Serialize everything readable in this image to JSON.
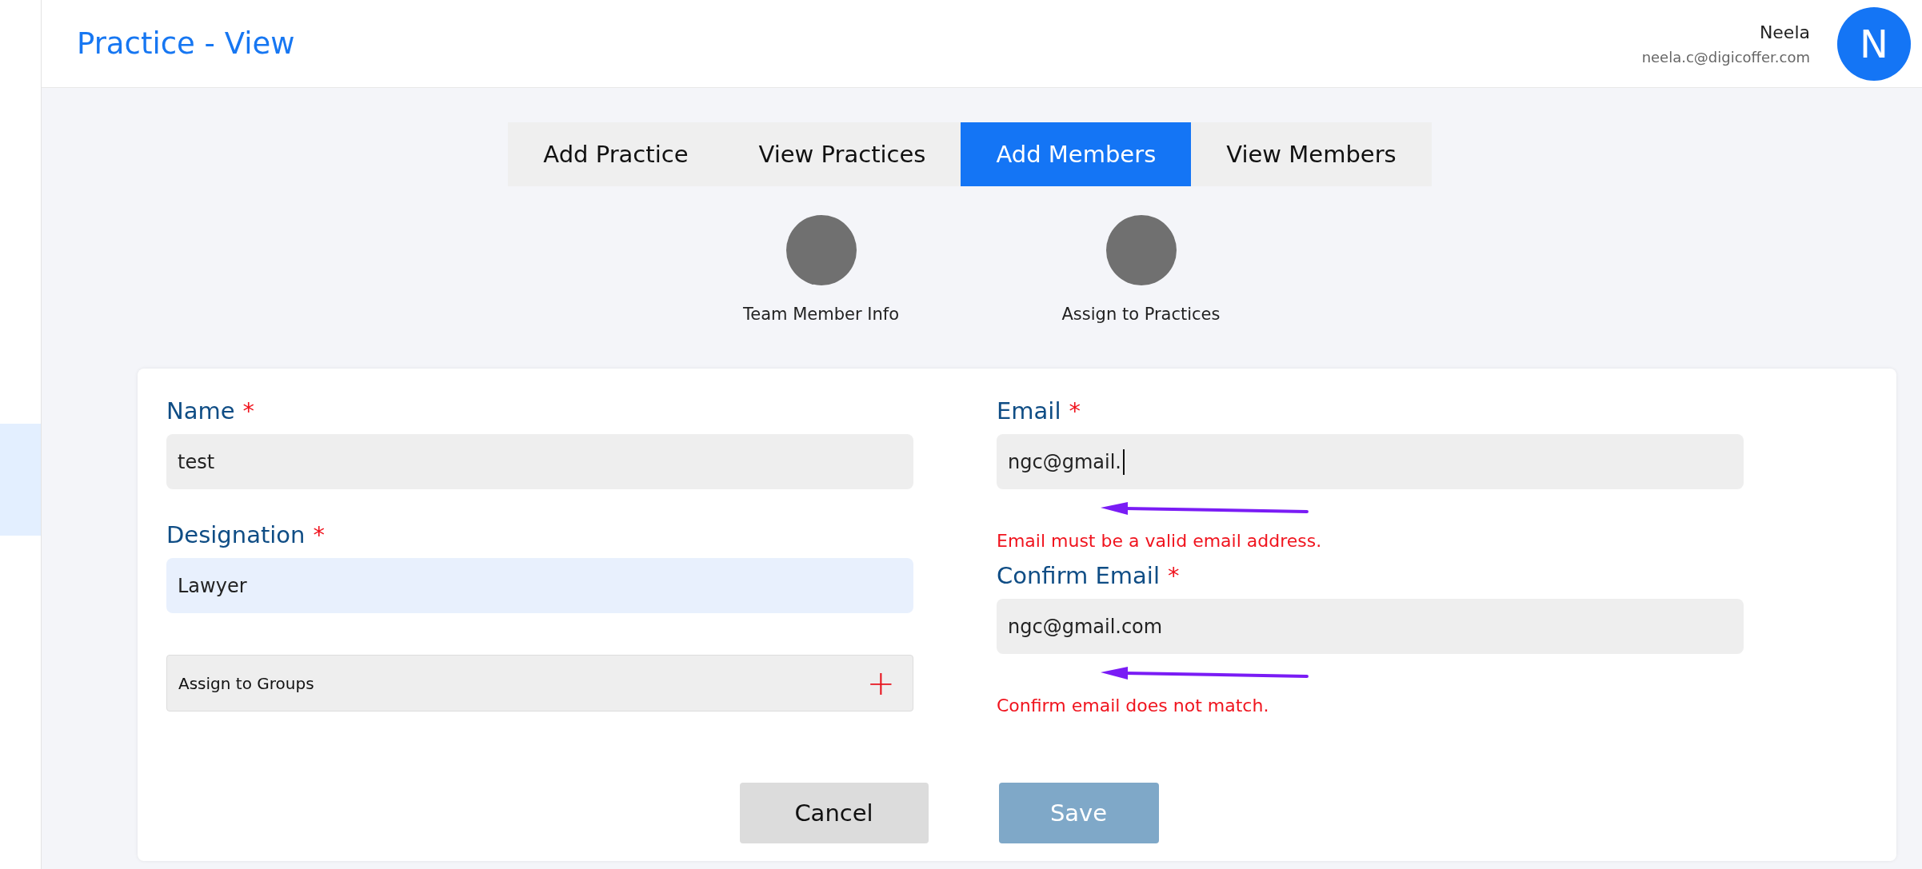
{
  "header": {
    "title": "Practice - View",
    "user": {
      "name": "Neela",
      "email": "neela.c@digicoffer.com",
      "initial": "N"
    }
  },
  "sidebar": {
    "items": [
      {
        "selected": true
      }
    ]
  },
  "tabs": [
    {
      "label": "Add Practice",
      "selected": false
    },
    {
      "label": "View Practices",
      "selected": false
    },
    {
      "label": "Add Members",
      "selected": true
    },
    {
      "label": "View Members",
      "selected": false
    }
  ],
  "steps": [
    {
      "label": "Team Member Info"
    },
    {
      "label": "Assign to Practices"
    }
  ],
  "form": {
    "left": [
      {
        "kind": "text",
        "label": "Name",
        "marker": "*",
        "value": "test",
        "autofilled": false,
        "focused": false
      },
      {
        "kind": "text",
        "label": "Designation",
        "marker": "*",
        "value": "Lawyer",
        "autofilled": true,
        "focused": false
      },
      {
        "kind": "picker",
        "label": "Assign to Groups",
        "icon": "+"
      }
    ],
    "right": [
      {
        "kind": "text",
        "label": "Email",
        "marker": "*",
        "value": "ngc@gmail.",
        "autofilled": false,
        "focused": true,
        "error": "Email must be a valid email address."
      },
      {
        "kind": "text",
        "label": "Confirm Email",
        "marker": "*",
        "value": "ngc@gmail.com",
        "autofilled": false,
        "focused": false,
        "error": "Confirm email does not match."
      }
    ],
    "buttons": [
      {
        "label": "Cancel",
        "kind": "secondary"
      },
      {
        "label": "Save",
        "kind": "primary"
      }
    ]
  }
}
